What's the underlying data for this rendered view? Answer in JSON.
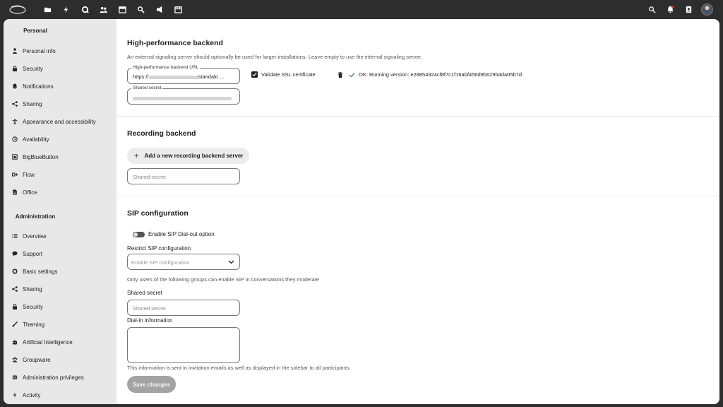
{
  "topbar": {
    "apps": [
      {
        "name": "files-icon",
        "glyph": "folder"
      },
      {
        "name": "activity-icon",
        "glyph": "bolt"
      },
      {
        "name": "talk-icon",
        "glyph": "talk"
      },
      {
        "name": "contacts-icon",
        "glyph": "people"
      },
      {
        "name": "calendar-icon",
        "glyph": "calendar"
      },
      {
        "name": "search-apps-icon",
        "glyph": "key"
      },
      {
        "name": "announcements-icon",
        "glyph": "megaphone"
      },
      {
        "name": "deck-icon",
        "glyph": "calendar2"
      }
    ]
  },
  "sidebar": {
    "personal_heading": "Personal",
    "personal_items": [
      {
        "label": "Personal info",
        "icon": "person-icon"
      },
      {
        "label": "Security",
        "icon": "lock-icon"
      },
      {
        "label": "Notifications",
        "icon": "bell-icon"
      },
      {
        "label": "Sharing",
        "icon": "share-icon"
      },
      {
        "label": "Appearance and accessibility",
        "icon": "accessibility-icon"
      },
      {
        "label": "Availability",
        "icon": "clock-icon"
      },
      {
        "label": "BigBlueButton",
        "icon": "bigbluebutton-icon"
      },
      {
        "label": "Flow",
        "icon": "flow-icon"
      },
      {
        "label": "Office",
        "icon": "document-icon"
      }
    ],
    "admin_heading": "Administration",
    "admin_items": [
      {
        "label": "Overview",
        "icon": "overview-icon"
      },
      {
        "label": "Support",
        "icon": "chat-icon"
      },
      {
        "label": "Basic settings",
        "icon": "gear-icon"
      },
      {
        "label": "Sharing",
        "icon": "share-icon"
      },
      {
        "label": "Security",
        "icon": "lock-icon"
      },
      {
        "label": "Theming",
        "icon": "brush-icon"
      },
      {
        "label": "Artificial Intelligence",
        "icon": "robot-icon"
      },
      {
        "label": "Groupware",
        "icon": "groupware-icon"
      },
      {
        "label": "Administration privileges",
        "icon": "globe-icon"
      },
      {
        "label": "Activity",
        "icon": "bolt-icon"
      }
    ]
  },
  "hpb": {
    "title": "High-performance backend",
    "description": "An external signaling server should optionally be used for larger installations. Leave empty to use the internal signaling server.",
    "url_label": "High-performance backend URL",
    "url_value_prefix": "https://",
    "url_value_suffix": "standalo  ...",
    "secret_label": "Shared secret",
    "validate_label": "Validate SSL certificate",
    "status": "OK: Running version: e28854324cf8f7c1f16abf456d9b629b4da05b7d"
  },
  "recording": {
    "title": "Recording backend",
    "add_label": "Add a new recording backend server",
    "secret_placeholder": "Shared secret"
  },
  "sip": {
    "title": "SIP configuration",
    "dialout_label": "Enable SIP Dial-out option",
    "restrict_label": "Restrict SIP configuration",
    "restrict_placeholder": "Enable SIP configuration",
    "restrict_help": "Only users of the following groups can enable SIP in conversations they moderate",
    "secret_label": "Shared secret",
    "secret_placeholder": "Shared secret",
    "dialin_label": "Dial-in information",
    "dialin_help": "This information is sent in invitation emails as well as displayed in the sidebar to all participants.",
    "save_label": "Save changes"
  }
}
